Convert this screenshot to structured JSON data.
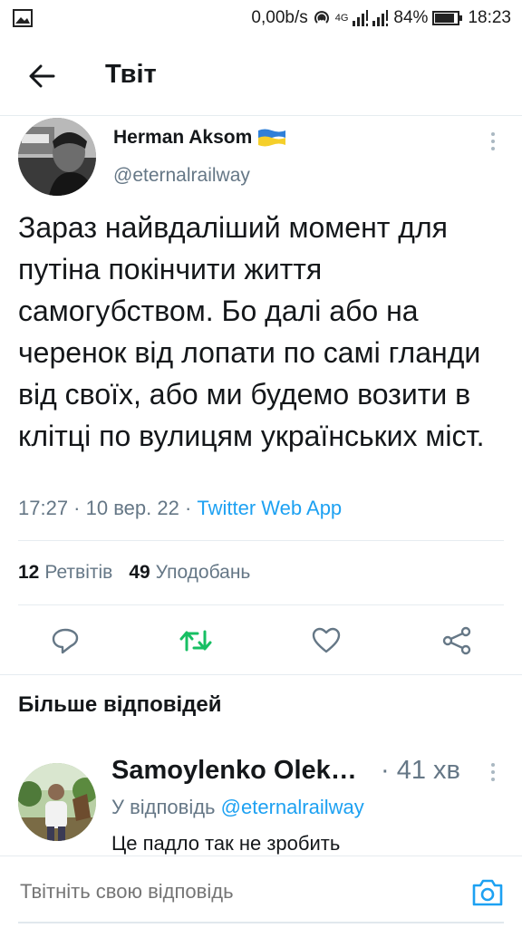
{
  "status_bar": {
    "network_speed": "0,00b/s",
    "signal_label": "4G",
    "battery": "84%",
    "time": "18:23",
    "icons": [
      "image-icon",
      "hotspot-icon",
      "signal-icon",
      "battery-icon"
    ]
  },
  "header": {
    "title": "Твіт",
    "back_icon": "arrow-left-icon"
  },
  "tweet": {
    "author_name": "Herman Aksom",
    "flag_icon": "ukraine-flag-icon",
    "handle": "@eternalrailway",
    "text": "Зараз найвдаліший момент для путіна покінчити життя самогубством. Бо далі або на черенок від лопати по самі гланди від своїх, або ми будемо возити в клітці по вулицям українських міст.",
    "time": "17:27",
    "separator": " · ",
    "date": "10 вер. 22",
    "source": "Twitter Web App",
    "retweets_count": "12",
    "retweets_label": "Ретвітів",
    "likes_count": "49",
    "likes_label": "Уподобань",
    "actions": [
      "reply-icon",
      "retweet-icon",
      "like-icon",
      "share-icon"
    ]
  },
  "more_replies": {
    "title": "Більше відповідей"
  },
  "reply": {
    "author_name": "Samoylenko Olek…",
    "time": "· 41 хв",
    "in_reply_prefix": "У відповідь",
    "in_reply_mention": "@eternalrailway",
    "text": "Це падло так не зробить"
  },
  "composer": {
    "placeholder": "Твітніть свою відповідь",
    "camera_icon": "camera-icon"
  },
  "colors": {
    "accent": "#1da1f2",
    "retweet_green": "#17bf63",
    "text_primary": "#14171a",
    "text_secondary": "#657786",
    "divider": "#e6ecf0"
  }
}
